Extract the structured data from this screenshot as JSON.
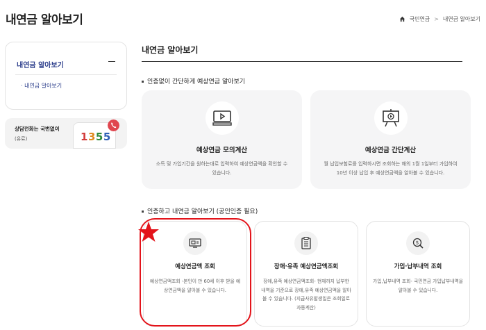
{
  "header": {
    "page_title": "내연금 알아보기",
    "breadcrumb": {
      "home": "국민연금",
      "current": "내연금 알아보기"
    }
  },
  "sidebar": {
    "menu_title": "내연금 알아보기",
    "sub_item": "· 내연금 알아보기",
    "call": {
      "label": "상담전화는 국번없이",
      "sub": "(유료)",
      "digits": [
        "1",
        "3",
        "5",
        "5"
      ]
    }
  },
  "main": {
    "title": "내연금 알아보기",
    "section1": {
      "title": "인증없이 간단하게 예상연금 알아보기",
      "cards": [
        {
          "icon": "video-monitor-icon",
          "title": "예상연금 모의계산",
          "desc": "소득 및 가입기간을 원하는대로 입력하여 예상연금액을 확인할 수 있습니다."
        },
        {
          "icon": "presentation-board-icon",
          "title": "예상연금 간단계산",
          "desc": "월 납입보험료를 입력하시면 조회하는 해의 1월 1일부터 가입하여 10년 이상 납입 후 예상연금액을 알아볼 수 있습니다."
        }
      ]
    },
    "section2": {
      "title": "인증하고 내연금 알아보기 (공인인증 필요)",
      "cards": [
        {
          "icon": "card-screen-icon",
          "title": "예상연금액 조회",
          "desc": "예상연금액조회 -본인이 만 60세 이후 받을 예상연금액을 알아볼 수 있습니다."
        },
        {
          "icon": "clipboard-list-icon",
          "title": "장애·유족 예상연금액조회",
          "desc": "장애,유족 예상연금액조회- 현재까지 납부한 내역을 기준으로 장애,유족 예상연금액을 알아볼 수 있습니다. (지급사유발생일은 조회일로 자동계산)"
        },
        {
          "icon": "coin-search-icon",
          "title": "가입·납부내역 조회",
          "desc": "가입,납부내역 조회- 국민연금 가입납부내역을 알아볼 수 있습니다."
        }
      ]
    }
  },
  "annotation": {
    "highlight_color": "#e3141b"
  }
}
